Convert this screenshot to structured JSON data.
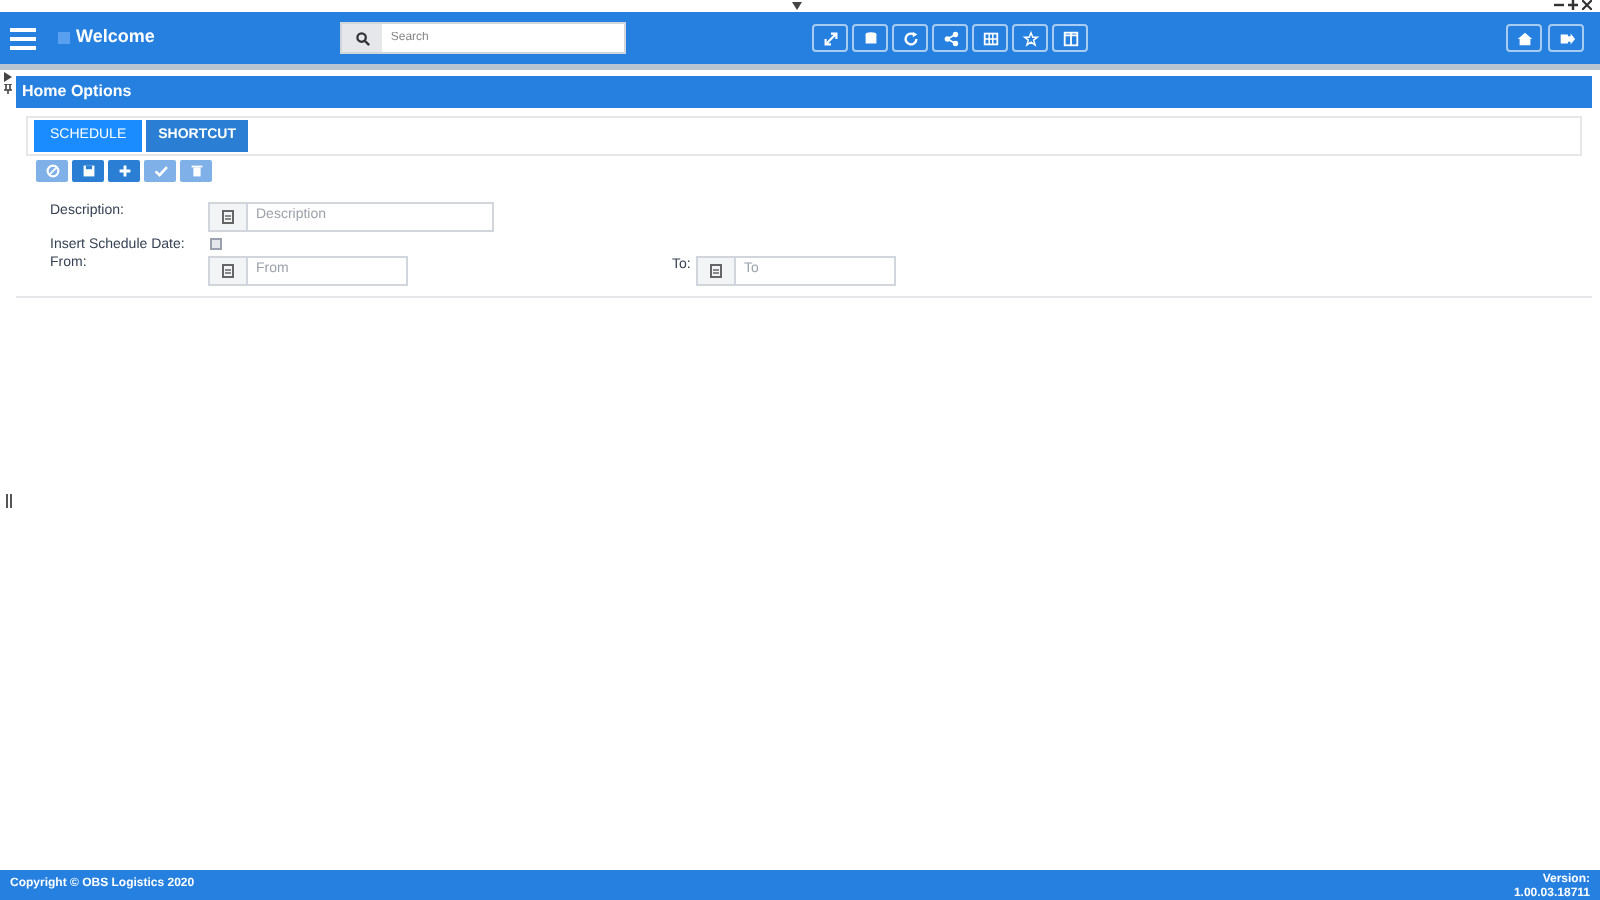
{
  "header": {
    "title": "Welcome",
    "search": {
      "placeholder": "Search"
    }
  },
  "panel": {
    "title": "Home Options"
  },
  "tabs": [
    {
      "label": "SCHEDULE",
      "selected": true
    },
    {
      "label": "SHORTCUT",
      "selected": false
    }
  ],
  "toolbar": [
    {
      "kind": "cancel",
      "disabled": true
    },
    {
      "kind": "save",
      "disabled": false
    },
    {
      "kind": "add",
      "disabled": false
    },
    {
      "kind": "confirm",
      "disabled": true
    },
    {
      "kind": "delete",
      "disabled": true
    }
  ],
  "form": {
    "description": {
      "label": "Description:",
      "placeholder": "Description"
    },
    "insert_schedule_date": {
      "label": "Insert Schedule Date:",
      "checked": false
    },
    "from": {
      "label": "From:",
      "placeholder": "From"
    },
    "to": {
      "label": "To:",
      "placeholder": "To"
    }
  },
  "footer": {
    "copyright": "Copyright © OBS Logistics 2020",
    "version_label": "Version:",
    "version": "1.00.03.18711"
  }
}
